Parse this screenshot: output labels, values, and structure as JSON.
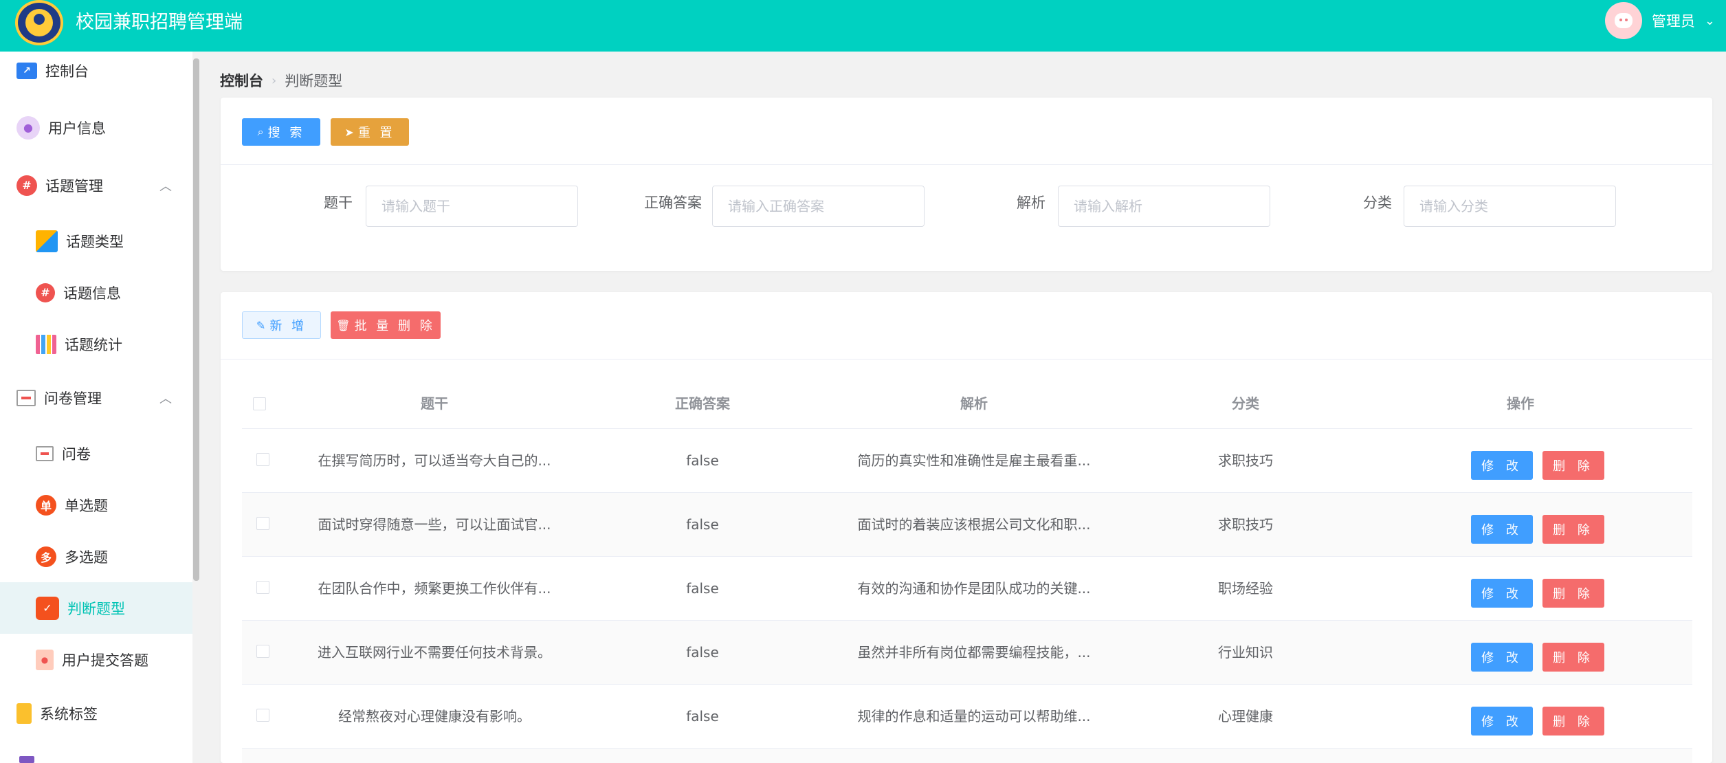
{
  "header": {
    "title": "校园兼职招聘管理端",
    "user_name": "管理员"
  },
  "sidebar": {
    "items": [
      {
        "label": "控制台"
      },
      {
        "label": "用户信息"
      },
      {
        "label": "话题管理"
      },
      {
        "label": "话题类型"
      },
      {
        "label": "话题信息"
      },
      {
        "label": "话题统计"
      },
      {
        "label": "问卷管理"
      },
      {
        "label": "问卷"
      },
      {
        "label": "单选题",
        "icon_text": "单"
      },
      {
        "label": "多选题",
        "icon_text": "多"
      },
      {
        "label": "判断题型"
      },
      {
        "label": "用户提交答题"
      },
      {
        "label": "系统标签"
      }
    ]
  },
  "breadcrumb": {
    "home": "控制台",
    "current": "判断题型"
  },
  "search": {
    "search_label": "搜 索",
    "reset_label": "重 置",
    "fields": [
      {
        "label": "题干",
        "placeholder": "请输入题干"
      },
      {
        "label": "正确答案",
        "placeholder": "请输入正确答案"
      },
      {
        "label": "解析",
        "placeholder": "请输入解析"
      },
      {
        "label": "分类",
        "placeholder": "请输入分类"
      }
    ]
  },
  "actions": {
    "add_label": "新 增",
    "batch_delete_label": "批 量 删 除"
  },
  "table": {
    "columns": [
      "题干",
      "正确答案",
      "解析",
      "分类",
      "操作"
    ],
    "edit_label": "修 改",
    "delete_label": "删 除",
    "rows": [
      {
        "stem": "在撰写简历时，可以适当夸大自己的...",
        "answer": "false",
        "analysis": "简历的真实性和准确性是雇主最看重...",
        "category": "求职技巧"
      },
      {
        "stem": "面试时穿得随意一些，可以让面试官...",
        "answer": "false",
        "analysis": "面试时的着装应该根据公司文化和职...",
        "category": "求职技巧"
      },
      {
        "stem": "在团队合作中，频繁更换工作伙伴有...",
        "answer": "false",
        "analysis": "有效的沟通和协作是团队成功的关键...",
        "category": "职场经验"
      },
      {
        "stem": "进入互联网行业不需要任何技术背景。",
        "answer": "false",
        "analysis": "虽然并非所有岗位都需要编程技能，...",
        "category": "行业知识"
      },
      {
        "stem": "经常熬夜对心理健康没有影响。",
        "answer": "false",
        "analysis": "规律的作息和适量的运动可以帮助维...",
        "category": "心理健康"
      }
    ]
  }
}
